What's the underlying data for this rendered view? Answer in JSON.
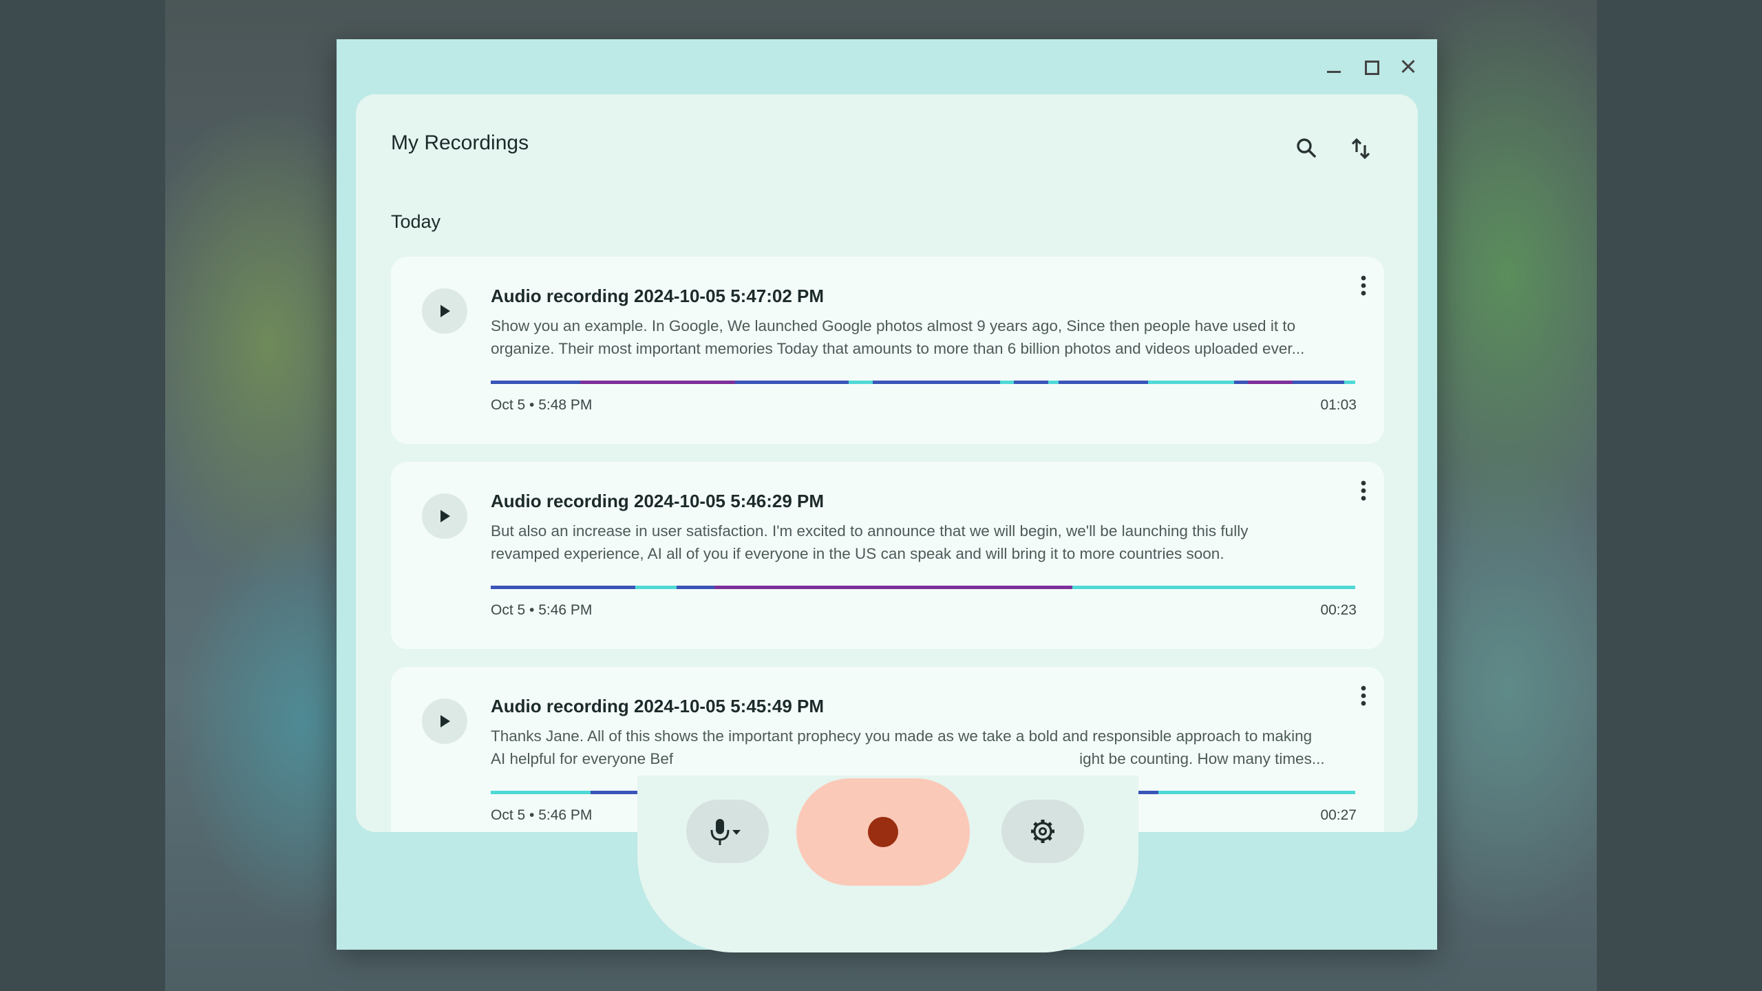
{
  "window": {
    "controls": {
      "minimize": "minimize-icon",
      "maximize": "maximize-icon",
      "close": "close-icon"
    }
  },
  "header": {
    "title": "My Recordings",
    "search_icon": "search-icon",
    "sort_icon": "sort-icon"
  },
  "section": {
    "label": "Today"
  },
  "recordings": [
    {
      "title": "Audio recording 2024-10-05 5:47:02 PM",
      "line1": "Show you an example. In Google, We launched Google photos almost 9 years ago, Since then people have used it to",
      "line2": "organize. Their most important memories Today that amounts to more than 6 billion photos and videos uploaded ever...",
      "date": "Oct 5 • 5:48 PM",
      "duration": "01:03"
    },
    {
      "title": "Audio recording 2024-10-05 5:46:29 PM",
      "line1": "But also an increase in user satisfaction. I'm excited to announce that we will begin, we'll be launching this fully",
      "line2": "revamped experience, AI all of you if everyone in the US can speak and will bring it to more countries soon.",
      "date": "Oct 5 • 5:46 PM",
      "duration": "00:23"
    },
    {
      "title": "Audio recording 2024-10-05 5:45:49 PM",
      "line1": "Thanks Jane. All of this shows the important prophecy you made as we take a bold and responsible approach to making",
      "line2": "AI helpful for everyone Bef",
      "line2b": "ight be counting. How many times...",
      "date": "Oct 5 • 5:46 PM",
      "duration": "00:27"
    }
  ],
  "colors": {
    "speaker_blue": "#3a55b8",
    "speaker_purple": "#7d2f9a",
    "speaker_cyan": "#4fd9d6",
    "record_accent": "#9a2e10"
  },
  "dock": {
    "mic_icon": "microphone-icon",
    "record_icon": "record-icon",
    "settings_icon": "gear-icon"
  }
}
